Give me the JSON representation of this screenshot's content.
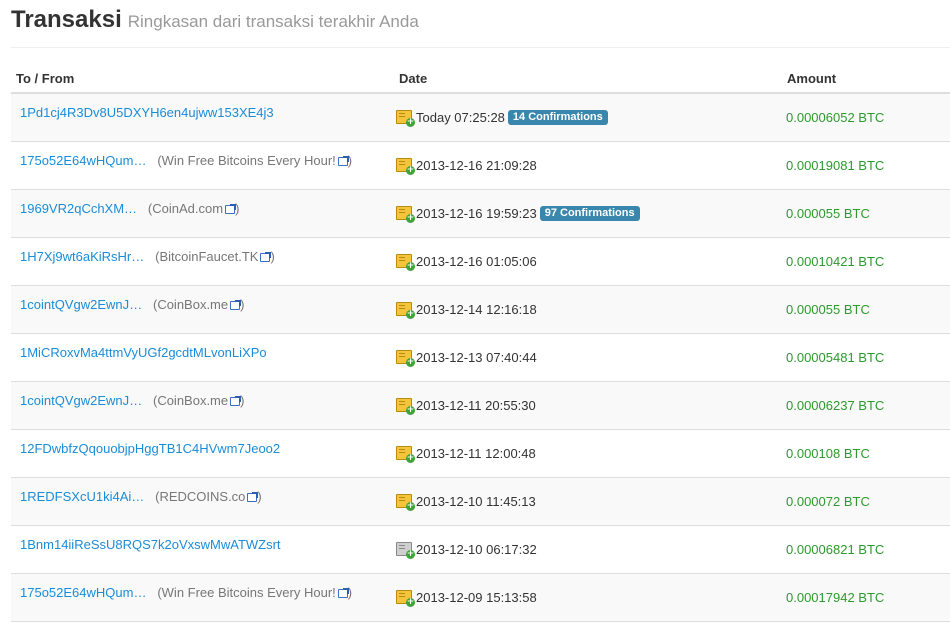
{
  "header": {
    "title": "Transaksi",
    "subtitle": "Ringkasan dari transaksi terakhir Anda"
  },
  "columns": {
    "to_from": "To / From",
    "date": "Date",
    "amount": "Amount"
  },
  "icons": {
    "receive": "received-coin-icon",
    "external": "external-link-icon"
  },
  "colors": {
    "link": "#1a8cd8",
    "amount": "#2d9a2d",
    "badge": "#3a87ad"
  },
  "rows": [
    {
      "addr": "1Pd1cj4R3Dv8U5DXYH6en4ujww153XE4j3",
      "site": "",
      "date": "Today 07:25:28",
      "conf": "14 Confirmations",
      "amount": "0.00006052 BTC",
      "icon": "gold"
    },
    {
      "addr": "175o52E64wHQum…",
      "site": "Win Free Bitcoins Every Hour!",
      "date": "2013-12-16 21:09:28",
      "conf": "",
      "amount": "0.00019081 BTC",
      "icon": "gold"
    },
    {
      "addr": "1969VR2qCchXM…",
      "site": "CoinAd.com",
      "date": "2013-12-16 19:59:23",
      "conf": "97 Confirmations",
      "amount": "0.000055 BTC",
      "icon": "gold"
    },
    {
      "addr": "1H7Xj9wt6aKiRsHr…",
      "site": "BitcoinFaucet.TK",
      "date": "2013-12-16 01:05:06",
      "conf": "",
      "amount": "0.00010421 BTC",
      "icon": "gold"
    },
    {
      "addr": "1cointQVgw2EwnJ…",
      "site": "CoinBox.me",
      "date": "2013-12-14 12:16:18",
      "conf": "",
      "amount": "0.000055 BTC",
      "icon": "gold"
    },
    {
      "addr": "1MiCRoxvMa4ttmVyUGf2gcdtMLvonLiXPo",
      "site": "",
      "date": "2013-12-13 07:40:44",
      "conf": "",
      "amount": "0.00005481 BTC",
      "icon": "gold"
    },
    {
      "addr": "1cointQVgw2EwnJ…",
      "site": "CoinBox.me",
      "date": "2013-12-11 20:55:30",
      "conf": "",
      "amount": "0.00006237 BTC",
      "icon": "gold"
    },
    {
      "addr": "12FDwbfzQqouobjpHggTB1C4HVwm7Jeoo2",
      "site": "",
      "date": "2013-12-11 12:00:48",
      "conf": "",
      "amount": "0.000108 BTC",
      "icon": "gold"
    },
    {
      "addr": "1REDFSXcU1ki4Ai…",
      "site": "REDCOINS.co",
      "date": "2013-12-10 11:45:13",
      "conf": "",
      "amount": "0.000072 BTC",
      "icon": "gold"
    },
    {
      "addr": "1Bnm14iiReSsU8RQS7k2oVxswMwATWZsrt",
      "site": "",
      "date": "2013-12-10 06:17:32",
      "conf": "",
      "amount": "0.00006821 BTC",
      "icon": "grey"
    },
    {
      "addr": "175o52E64wHQum…",
      "site": "Win Free Bitcoins Every Hour!",
      "date": "2013-12-09 15:13:58",
      "conf": "",
      "amount": "0.00017942 BTC",
      "icon": "gold"
    }
  ]
}
